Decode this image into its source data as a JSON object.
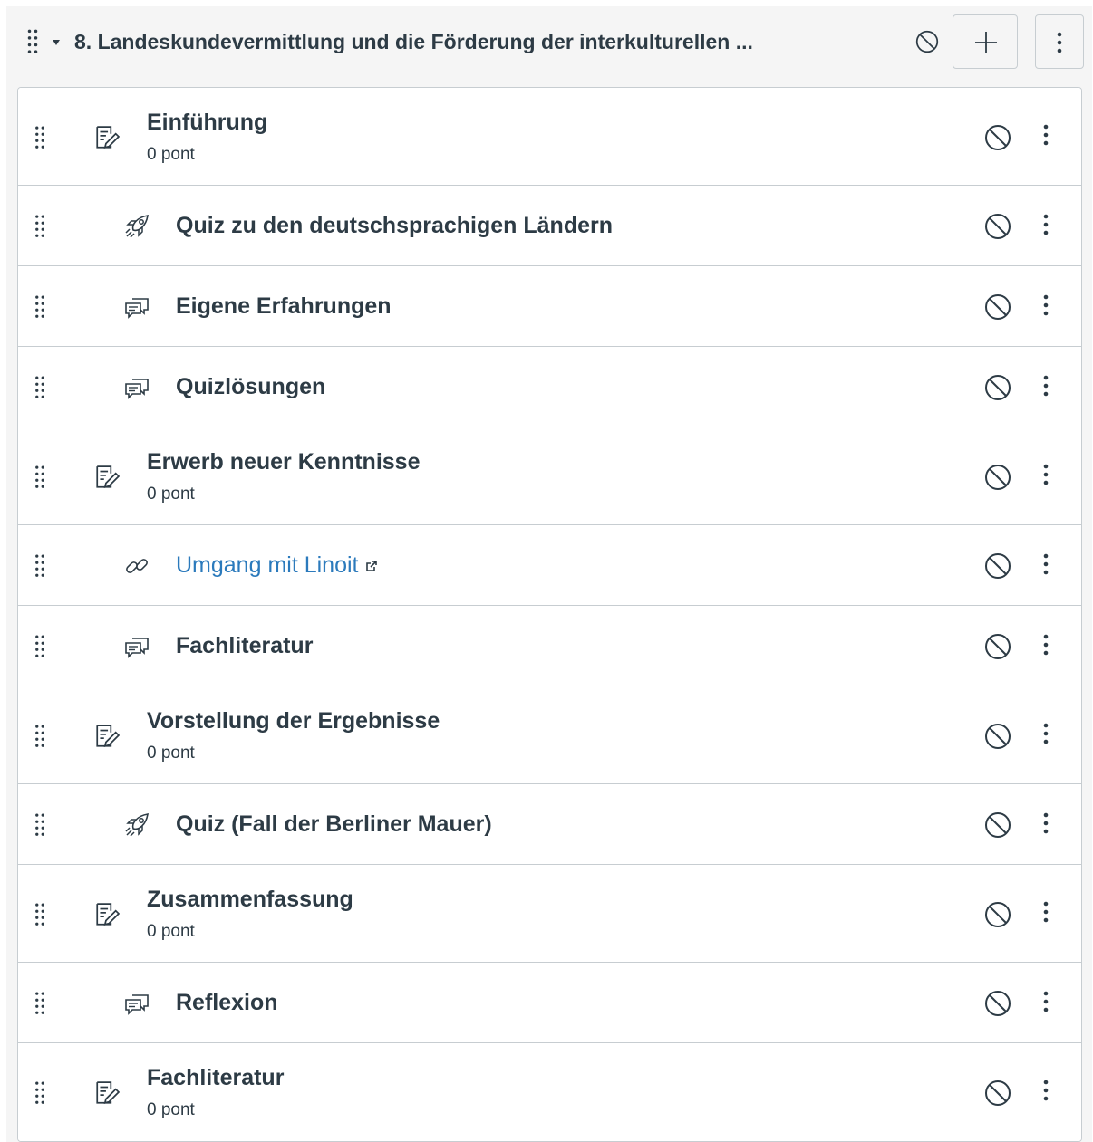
{
  "module": {
    "title": "8. Landeskundevermittlung und die Förderung der interkulturellen ...",
    "icons": {
      "drag": "drag-handle-icon",
      "collapse": "caret-down-icon",
      "unpublished": "unpublished-icon",
      "add": "plus-icon",
      "menu": "kebab-icon"
    }
  },
  "items": [
    {
      "title": "Einführung",
      "points": "0 pont",
      "type": "assignment",
      "icon": "assignment-icon",
      "indent": false
    },
    {
      "title": "Quiz zu den deutschsprachigen Ländern",
      "type": "quiz",
      "icon": "rocket-quiz-icon",
      "indent": true
    },
    {
      "title": "Eigene Erfahrungen",
      "type": "discussion",
      "icon": "discussion-icon",
      "indent": true
    },
    {
      "title": "Quizlösungen",
      "type": "discussion",
      "icon": "discussion-icon",
      "indent": true
    },
    {
      "title": "Erwerb neuer Kenntnisse",
      "points": "0 pont",
      "type": "assignment",
      "icon": "assignment-icon",
      "indent": false
    },
    {
      "title": "Umgang mit Linoit",
      "type": "external-link",
      "icon": "link-icon",
      "indent": true,
      "link_color": "#2b7abc"
    },
    {
      "title": "Fachliteratur",
      "type": "discussion",
      "icon": "discussion-icon",
      "indent": true
    },
    {
      "title": "Vorstellung der Ergebnisse",
      "points": "0 pont",
      "type": "assignment",
      "icon": "assignment-icon",
      "indent": false
    },
    {
      "title": "Quiz (Fall der Berliner Mauer)",
      "type": "quiz",
      "icon": "rocket-quiz-icon",
      "indent": true
    },
    {
      "title": "Zusammenfassung",
      "points": "0 pont",
      "type": "assignment",
      "icon": "assignment-icon",
      "indent": false
    },
    {
      "title": "Reflexion",
      "type": "discussion",
      "icon": "discussion-icon",
      "indent": true
    },
    {
      "title": "Fachliteratur",
      "points": "0 pont",
      "type": "assignment",
      "icon": "assignment-icon",
      "indent": false
    }
  ],
  "colors": {
    "text": "#2d3b45",
    "link": "#2b7abc",
    "border": "#c7cdd1",
    "header_bg": "#f5f5f5"
  }
}
